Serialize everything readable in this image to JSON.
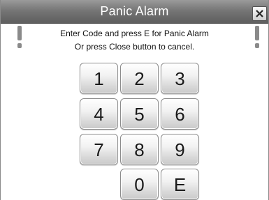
{
  "dialog": {
    "title": "Panic Alarm",
    "close_icon": "close-x-icon",
    "warning_icon": "exclamation-icon",
    "instruction_line1": "Enter Code and press E for Panic Alarm",
    "instruction_line2": "Or press Close button to cancel."
  },
  "keypad": {
    "keys": [
      "1",
      "2",
      "3",
      "4",
      "5",
      "6",
      "7",
      "8",
      "9",
      "0",
      "E"
    ]
  },
  "colors": {
    "titlebar": "#767676",
    "title_text": "#ffffff",
    "key_face": "#e8e8e8"
  }
}
